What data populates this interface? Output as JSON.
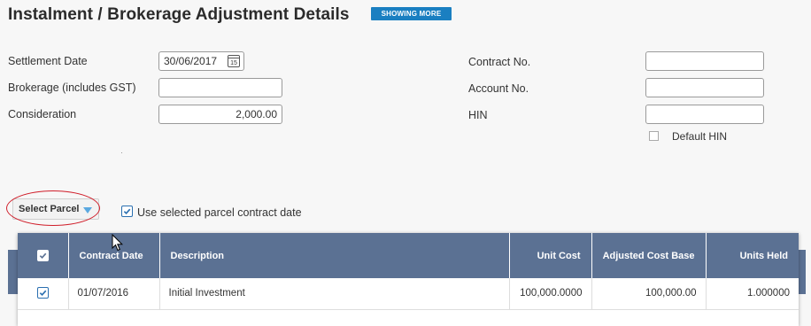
{
  "page": {
    "title": "Instalment / Brokerage Adjustment Details",
    "showing_more": "SHOWING MORE"
  },
  "left_form": {
    "settlement_date": {
      "label": "Settlement Date",
      "value": "30/06/2017",
      "calendar_day": "15"
    },
    "brokerage": {
      "label": "Brokerage (includes GST)",
      "value": ""
    },
    "consideration": {
      "label": "Consideration",
      "value": "2,000.00"
    }
  },
  "right_form": {
    "contract_no": {
      "label": "Contract No.",
      "value": ""
    },
    "account_no": {
      "label": "Account No.",
      "value": ""
    },
    "hin": {
      "label": "HIN",
      "value": ""
    },
    "default_hin": {
      "label": "Default HIN",
      "checked": false
    }
  },
  "parcel": {
    "select_label": "Select Parcel",
    "use_contract_date_label": "Use selected parcel contract date",
    "use_contract_date_checked": true
  },
  "table": {
    "columns": [
      "Contract Date",
      "Description",
      "Unit Cost",
      "Adjusted Cost Base",
      "Units Held"
    ],
    "rows": [
      {
        "checked": true,
        "contract_date": "01/07/2016",
        "description": "Initial Investment",
        "unit_cost": "100,000.0000",
        "adjusted_cost_base": "100,000.00",
        "units_held": "1.000000"
      }
    ]
  },
  "colors": {
    "accent": "#1a7fc1",
    "table_header": "#5b7193",
    "annotation": "#d01e2a"
  }
}
